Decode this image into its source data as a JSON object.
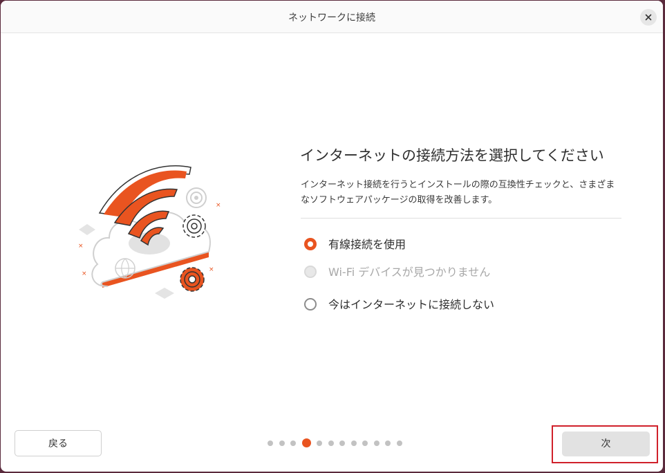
{
  "window": {
    "title": "ネットワークに接続"
  },
  "main": {
    "heading": "インターネットの接続方法を選択してください",
    "description": "インターネット接続を行うとインストールの際の互換性チェックと、さまざまなソフトウェアパッケージの取得を改善します。",
    "options": [
      {
        "label": "有線接続を使用",
        "selected": true,
        "disabled": false
      },
      {
        "label": "Wi-Fi デバイスが見つかりません",
        "selected": false,
        "disabled": true
      },
      {
        "label": "今はインターネットに接続しない",
        "selected": false,
        "disabled": false
      }
    ]
  },
  "footer": {
    "back_label": "戻る",
    "next_label": "次",
    "pagination": {
      "total": 12,
      "current": 4
    }
  },
  "colors": {
    "accent": "#e95420",
    "highlight": "#d0202a"
  },
  "icons": [
    "close-icon",
    "network-cloud-illustration"
  ]
}
